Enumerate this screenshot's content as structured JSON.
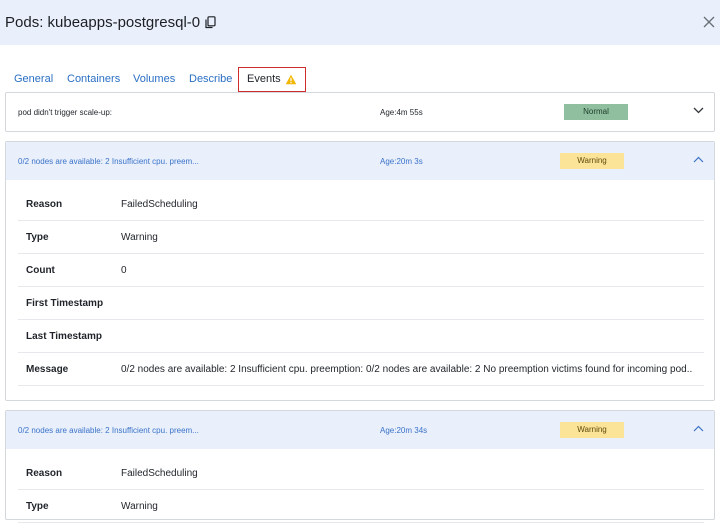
{
  "header": {
    "title": "Pods: kubeapps-postgresql-0"
  },
  "tabs": [
    {
      "label": "General"
    },
    {
      "label": "Containers"
    },
    {
      "label": "Volumes"
    },
    {
      "label": "Describe"
    },
    {
      "label": "Events"
    }
  ],
  "events": [
    {
      "message": "pod didn't trigger scale-up:",
      "age": "Age:4m 55s",
      "status": "Normal"
    },
    {
      "message": "0/2 nodes are available: 2 Insufficient cpu. preem...",
      "age": "Age:20m 3s",
      "status": "Warning",
      "details": {
        "reason_label": "Reason",
        "reason": "FailedScheduling",
        "type_label": "Type",
        "type": "Warning",
        "count_label": "Count",
        "count": "0",
        "first_label": "First Timestamp",
        "first": "",
        "last_label": "Last Timestamp",
        "last": "",
        "message_label": "Message",
        "message": "0/2 nodes are available: 2 Insufficient cpu. preemption: 0/2 nodes are available: 2 No preemption victims found for incoming pod.."
      }
    },
    {
      "message": "0/2 nodes are available: 2 Insufficient cpu. preem...",
      "age": "Age:20m 34s",
      "status": "Warning",
      "details": {
        "reason_label": "Reason",
        "reason": "FailedScheduling",
        "type_label": "Type",
        "type": "Warning"
      }
    }
  ],
  "colors": {
    "header_bg": "#e9f0fb",
    "link": "#2b6fc4",
    "warning_badge": "#fbe397",
    "normal_badge": "#8fbf9f",
    "active_tab_border": "#cc2e2e",
    "warning_icon": "#f2b705"
  },
  "icons": {
    "copy": "copy-icon",
    "close": "close-icon",
    "warning": "warning-icon",
    "expand": "chevron-down-icon",
    "collapse": "chevron-up-icon"
  }
}
